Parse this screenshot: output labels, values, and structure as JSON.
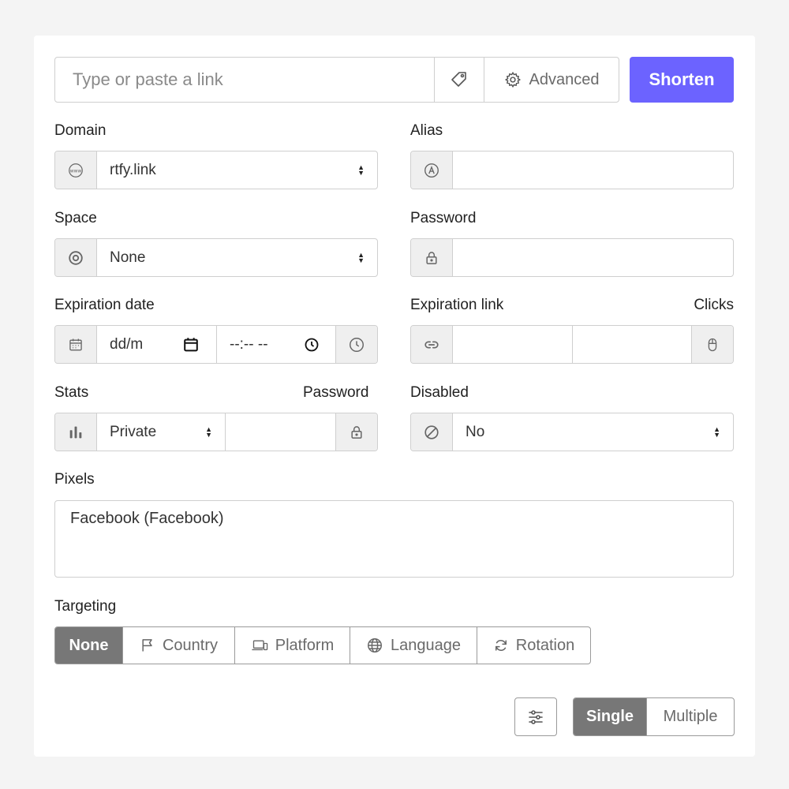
{
  "link_bar": {
    "placeholder": "Type or paste a link",
    "advanced_label": "Advanced",
    "shorten_label": "Shorten"
  },
  "domain": {
    "label": "Domain",
    "value": "rtfy.link"
  },
  "alias": {
    "label": "Alias",
    "value": ""
  },
  "space": {
    "label": "Space",
    "value": "None"
  },
  "password": {
    "label": "Password",
    "value": ""
  },
  "expiration_date": {
    "label": "Expiration date",
    "date_placeholder": "dd/m",
    "time_placeholder": "--:-- --"
  },
  "expiration_link": {
    "label": "Expiration link",
    "clicks_label": "Clicks"
  },
  "stats": {
    "label": "Stats",
    "value": "Private",
    "password_label": "Password"
  },
  "disabled": {
    "label": "Disabled",
    "value": "No"
  },
  "pixels": {
    "label": "Pixels",
    "value": "Facebook (Facebook)"
  },
  "targeting": {
    "label": "Targeting",
    "options": [
      "None",
      "Country",
      "Platform",
      "Language",
      "Rotation"
    ],
    "selected": "None"
  },
  "mode": {
    "options": [
      "Single",
      "Multiple"
    ],
    "selected": "Single"
  },
  "colors": {
    "accent": "#6c63ff",
    "active_segment": "#777777",
    "addon_bg": "#efefef"
  }
}
